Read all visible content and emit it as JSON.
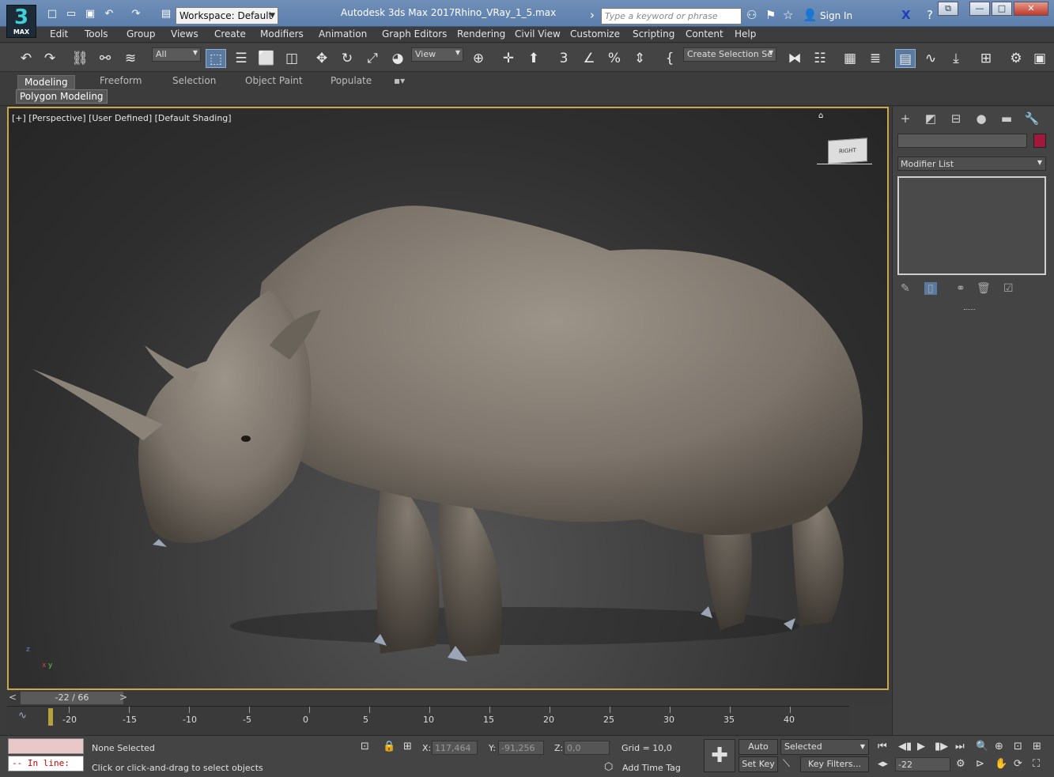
{
  "title": {
    "app": "Autodesk 3ds Max 2017",
    "file": "Rhino_VRay_1_5.max",
    "workspace": "Workspace: Default",
    "search_placeholder": "Type a keyword or phrase",
    "sign_in": "Sign In",
    "logo": "3",
    "logo_sub": "MAX"
  },
  "menu": [
    "Edit",
    "Tools",
    "Group",
    "Views",
    "Create",
    "Modifiers",
    "Animation",
    "Graph Editors",
    "Rendering",
    "Civil View",
    "Customize",
    "Scripting",
    "Content",
    "Help"
  ],
  "toolbar": {
    "filter": "All",
    "ref_coord": "View",
    "selection_set": "Create Selection Se"
  },
  "ribbon": {
    "tabs": [
      "Modeling",
      "Freeform",
      "Selection",
      "Object Paint",
      "Populate"
    ],
    "panel": "Polygon Modeling"
  },
  "viewport": {
    "label": "[+] [Perspective] [User Defined] [Default Shading]",
    "cube": "RIGHT",
    "axis_z": "z",
    "axis_x": "x",
    "axis_y": "y"
  },
  "command_panel": {
    "modifier_list": "Modifier List",
    "color": "#a0193c"
  },
  "timeline": {
    "position": "-22 / 66",
    "ticks": [
      "-20",
      "-15",
      "-10",
      "-5",
      "0",
      "5",
      "10",
      "15",
      "20",
      "25",
      "30",
      "35",
      "40"
    ]
  },
  "status": {
    "maxscript_line": "--  In line:",
    "selected": "None Selected",
    "prompt": "Click or click-and-drag to select objects",
    "x_label": "X:",
    "x": "117,464",
    "y_label": "Y:",
    "y": "-91,256",
    "z_label": "Z:",
    "z": "0,0",
    "grid": "Grid = 10,0",
    "add_time_tag": "Add Time Tag",
    "auto_key": "Auto Key",
    "set_key": "Set Key",
    "key_mode": "Selected",
    "key_filters": "Key Filters...",
    "frame": "-22"
  }
}
